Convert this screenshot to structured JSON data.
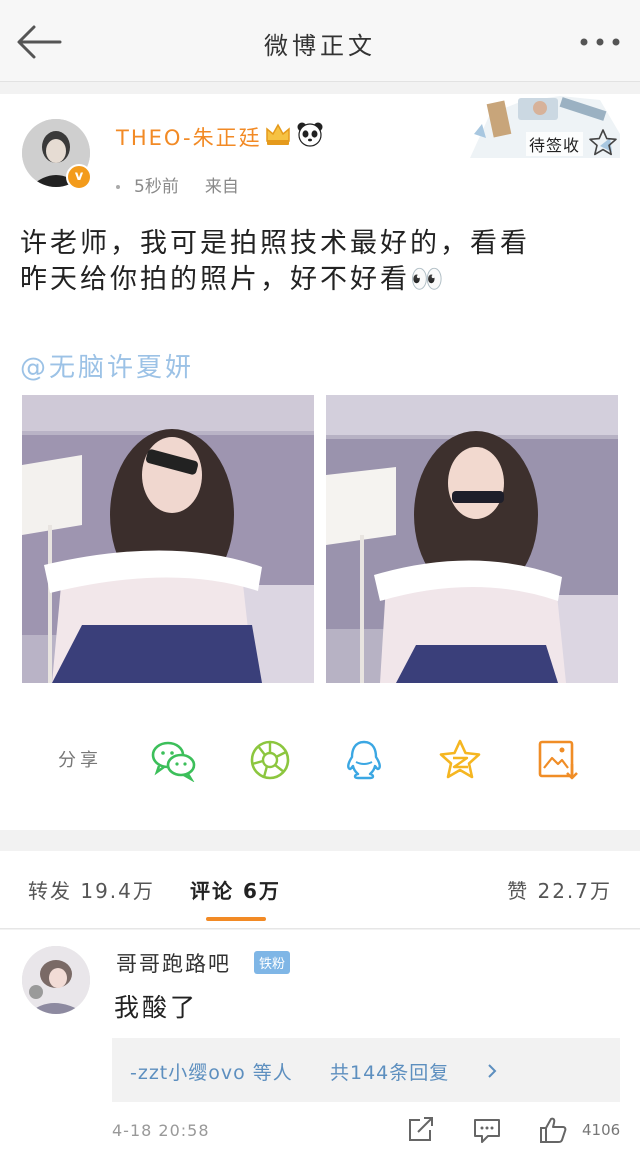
{
  "nav": {
    "title": "微博正文"
  },
  "post": {
    "username": "THEO-朱正廷",
    "time": "5秒前",
    "source": "来自",
    "decor_label": "待签收",
    "text": "许老师，我可是拍照技术最好的，看看昨天给你拍的照片，好不好看👀",
    "mention": "@无脑许夏妍",
    "share_label": "分享"
  },
  "tabs": {
    "repost": "转发 19.4万",
    "comments": "评论 6万",
    "likes": "赞 22.7万"
  },
  "comment": {
    "name": "哥哥跑路吧",
    "fan_badge": "铁粉",
    "text": "我酸了",
    "replies_who": "-zzt小缨ovo 等人",
    "replies_count": "共144条回复",
    "time": "4-18 20:58",
    "likes": "4106"
  },
  "colors": {
    "accent": "#f28a25",
    "mention": "#9cc2e6",
    "link": "#5d8fbf"
  },
  "icons": [
    "back-arrow-icon",
    "more-icon",
    "crown-icon",
    "panda-icon",
    "star-icon",
    "wechat-icon",
    "moments-icon",
    "qq-icon",
    "qzone-icon",
    "save-image-icon",
    "repost-icon",
    "comment-icon",
    "like-icon"
  ]
}
